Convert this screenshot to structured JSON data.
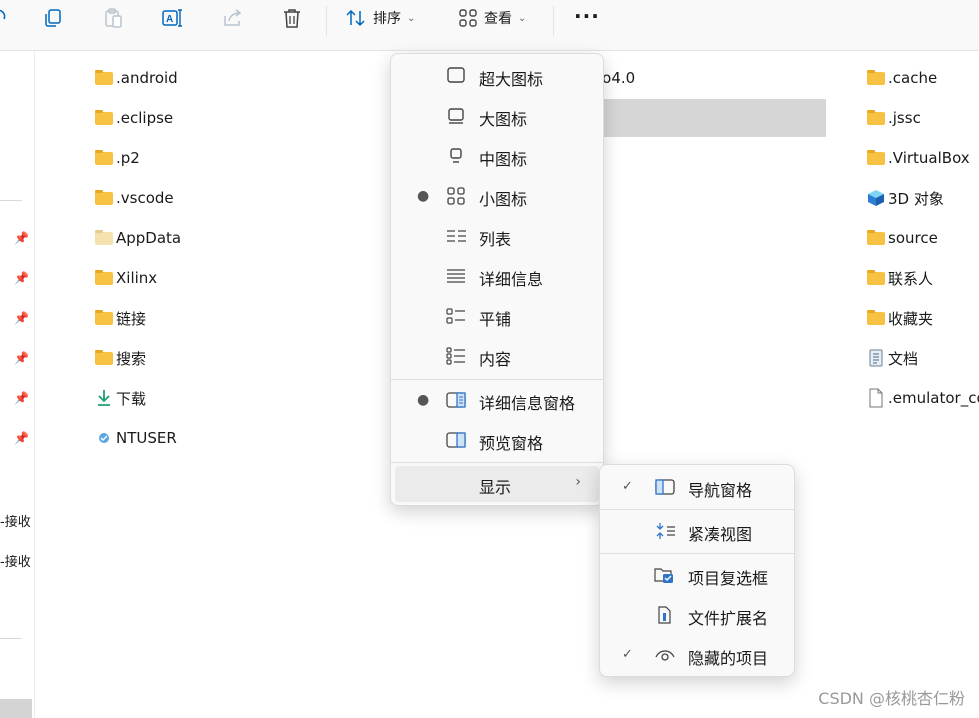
{
  "toolbar": {
    "sort_label": "排序",
    "view_label": "查看",
    "more_label": "···"
  },
  "leftnav": {
    "items": [
      {
        "label": "-接收"
      },
      {
        "label": "-接收"
      }
    ]
  },
  "files": {
    "col1": [
      {
        "name": ".android",
        "icon": "folder-icon"
      },
      {
        "name": ".eclipse",
        "icon": "folder-icon"
      },
      {
        "name": ".p2",
        "icon": "folder-icon"
      },
      {
        "name": ".vscode",
        "icon": "folder-icon"
      },
      {
        "name": "AppData",
        "icon": "folder-light-icon"
      },
      {
        "name": "Xilinx",
        "icon": "folder-icon"
      },
      {
        "name": "链接",
        "icon": "folder-icon"
      },
      {
        "name": "搜索",
        "icon": "folder-icon"
      },
      {
        "name": "下载",
        "icon": "download-icon"
      },
      {
        "name": "NTUSER",
        "icon": "system-file-icon"
      }
    ],
    "col2_partial": "io4.0",
    "col3": [
      {
        "name": ".cache",
        "icon": "folder-icon"
      },
      {
        "name": ".jssc",
        "icon": "folder-icon"
      },
      {
        "name": ".VirtualBox",
        "icon": "folder-icon"
      },
      {
        "name": "3D 对象",
        "icon": "cube-3d-icon"
      },
      {
        "name": "source",
        "icon": "folder-icon"
      },
      {
        "name": "联系人",
        "icon": "folder-icon"
      },
      {
        "name": "收藏夹",
        "icon": "folder-icon"
      },
      {
        "name": "文档",
        "icon": "document-icon"
      },
      {
        "name": ".emulator_co",
        "icon": "file-icon"
      }
    ]
  },
  "view_menu": {
    "items": [
      {
        "label": "超大图标",
        "icon": "extra-large-icons-icon",
        "selected": false
      },
      {
        "label": "大图标",
        "icon": "large-icons-icon",
        "selected": false
      },
      {
        "label": "中图标",
        "icon": "medium-icons-icon",
        "selected": false
      },
      {
        "label": "小图标",
        "icon": "small-icons-icon",
        "selected": true
      },
      {
        "label": "列表",
        "icon": "list-icon",
        "selected": false
      },
      {
        "label": "详细信息",
        "icon": "details-icon",
        "selected": false
      },
      {
        "label": "平铺",
        "icon": "tiles-icon",
        "selected": false
      },
      {
        "label": "内容",
        "icon": "content-icon",
        "selected": false
      }
    ],
    "pane_items": [
      {
        "label": "详细信息窗格",
        "icon": "details-pane-icon",
        "selected": true
      },
      {
        "label": "预览窗格",
        "icon": "preview-pane-icon",
        "selected": false
      }
    ],
    "show_label": "显示"
  },
  "show_submenu": {
    "items": [
      {
        "label": "导航窗格",
        "icon": "navigation-pane-icon",
        "checked": true
      },
      {
        "label": "紧凑视图",
        "icon": "compact-view-icon",
        "checked": false
      },
      {
        "label": "项目复选框",
        "icon": "item-checkboxes-icon",
        "checked": false
      },
      {
        "label": "文件扩展名",
        "icon": "file-extensions-icon",
        "checked": false
      },
      {
        "label": "隐藏的项目",
        "icon": "hidden-items-icon",
        "checked": true
      }
    ]
  },
  "watermark": "CSDN @核桃杏仁粉",
  "colors": {
    "accent": "#0067c0",
    "folder": "#f7c144",
    "hover": "#ebebeb"
  }
}
